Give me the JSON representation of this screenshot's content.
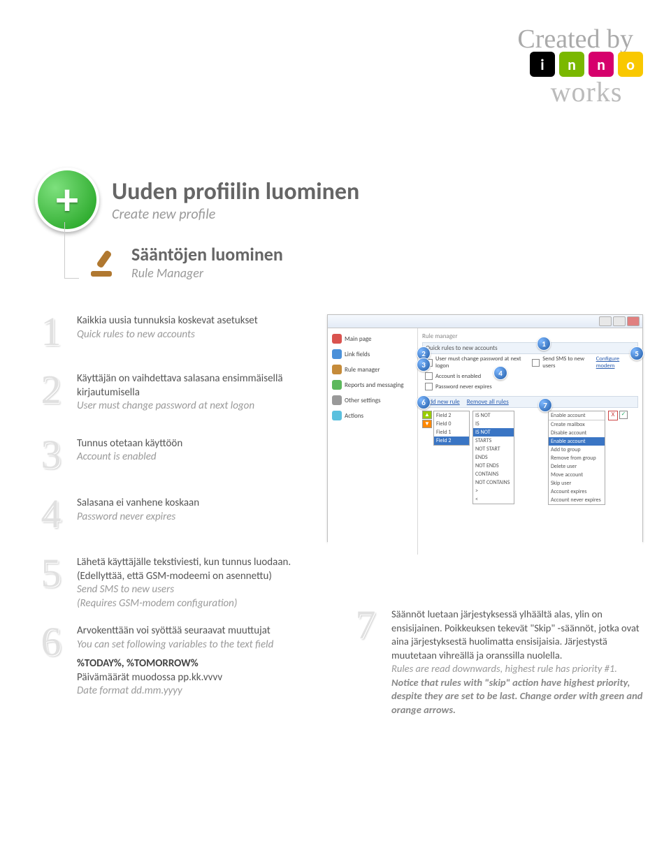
{
  "header": {
    "created_by": "Created by",
    "logo_letters": [
      "i",
      "n",
      "n",
      "o"
    ],
    "logo_text": "works"
  },
  "title": {
    "fi": "Uuden profiilin luominen",
    "en": "Create new profile",
    "sub_fi": "Sääntöjen luominen",
    "sub_en": "Rule Manager"
  },
  "steps_left": [
    {
      "n": "1",
      "fi": "Kaikkia uusia tunnuksia koskevat asetukset",
      "en": "Quick rules to new accounts"
    },
    {
      "n": "2",
      "fi": "Käyttäjän on vaihdettava salasana ensimmäisellä kirjautumisella",
      "en": "User must change password at next logon"
    },
    {
      "n": "3",
      "fi": "Tunnus otetaan käyttöön",
      "en": "Account is enabled"
    },
    {
      "n": "4",
      "fi": "Salasana ei vanhene koskaan",
      "en": "Password never expires"
    }
  ],
  "step5": {
    "n": "5",
    "fi_a": "Lähetä käyttäjälle tekstiviesti, kun tunnus luodaan. (Edellyttää, että GSM-modeemi on asennettu)",
    "en_a": "Send SMS to new users",
    "en_a2": "(Requires GSM-modem configuration)"
  },
  "step6": {
    "n": "6",
    "fi": "Arvokenttään voi syöttää seuraavat muuttujat",
    "en": "You can set following variables to the text field",
    "vars": "%TODAY%, %TOMORROW%",
    "fi2": "Päivämäärät muodossa pp.kk.vvvv",
    "en2": "Date format dd.mm.yyyy"
  },
  "step7": {
    "n": "7",
    "fi": "Säännöt luetaan järjestyksessä ylhäältä alas, ylin on ensisijainen. Poikkeuksen tekevät \"Skip\" ‑säännöt, jotka ovat aina järjestyksestä huolimatta ensisijaisia. Järjestystä muutetaan vihreällä ja oranssilla nuolella.",
    "en_a": "Rules are read downwards, highest rule has priority #1. ",
    "en_b": "Notice that rules with \"skip\" action have highest priority, despite they are set to be last. Change order with green and orange arrows."
  },
  "screenshot": {
    "sidebar": [
      "Main page",
      "Link fields",
      "Rule manager",
      "Reports and messaging",
      "Other settings",
      "Actions"
    ],
    "pane_title": "Rule manager",
    "quick": "Quick rules to new accounts",
    "chk1": "User must change password at next logon",
    "chk1b": "Send SMS to new users",
    "chk1c": "Configure modem",
    "chk2": "Account is enabled",
    "chk3": "Password never expires",
    "addremove_a": "Add new rule",
    "addremove_b": "Remove all rules",
    "fields": [
      "Field 2",
      "Field 0",
      "Field 1",
      "Field 2"
    ],
    "ops": [
      "IS NOT",
      "IS",
      "IS NOT",
      "STARTS",
      "NOT START",
      "ENDS",
      "NOT ENDS",
      "CONTAINS",
      "NOT CONTAINS",
      ">",
      "<"
    ],
    "act_head": "Enable account",
    "actions": [
      "Create mailbox",
      "Disable account",
      "Enable account",
      "Add to group",
      "Remove from group",
      "Delete user",
      "Move account",
      "Skip user",
      "Account expires",
      "Account never expires"
    ]
  }
}
